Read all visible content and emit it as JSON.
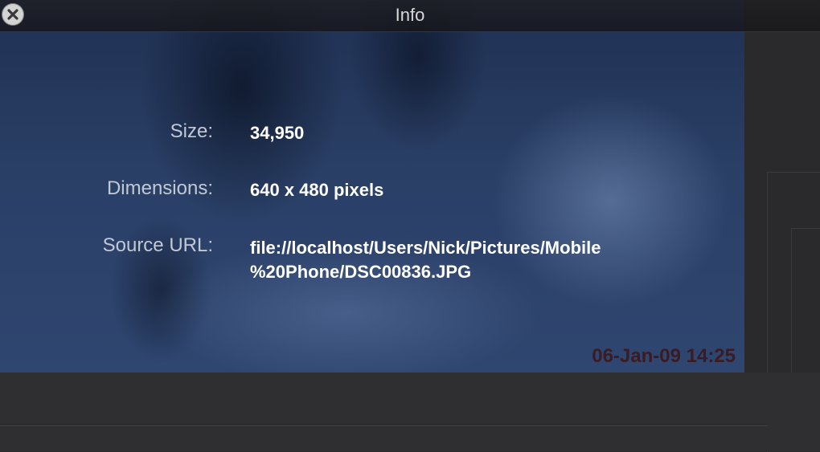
{
  "window": {
    "title": "Info"
  },
  "info_rows": [
    {
      "label": "Size:",
      "value": "34,950"
    },
    {
      "label": "Dimensions:",
      "value": "640 x 480 pixels"
    },
    {
      "label": "Source URL:",
      "value": "file://localhost/Users/Nick/Pictures/Mobile %20Phone/DSC00836.JPG"
    }
  ],
  "photo": {
    "timestamp": "06-Jan-09 14:25"
  },
  "icons": {
    "close": "close-icon"
  },
  "colors": {
    "photo_tint": "#2a3f66",
    "label_text": "#c2c8d4",
    "value_text": "#ffffff",
    "timestamp_text": "#3e1414"
  }
}
